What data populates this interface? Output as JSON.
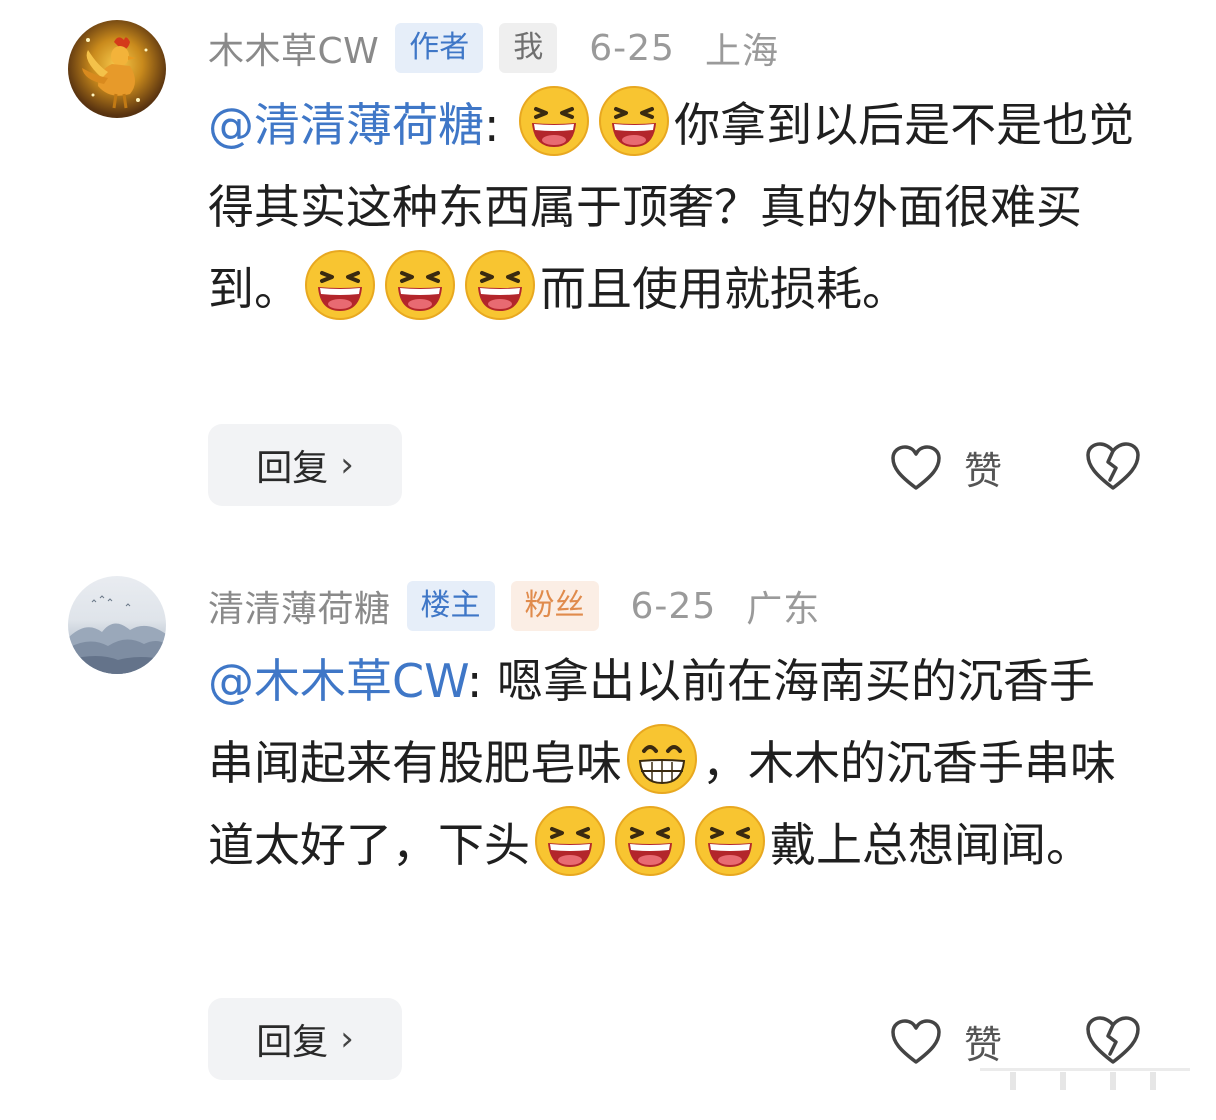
{
  "comments": [
    {
      "username": "木木草CW",
      "tags": [
        "作者",
        "我"
      ],
      "date": "6-25",
      "location": "上海",
      "mention": "@清清薄荷糖",
      "text_1": ": ",
      "text_2": "你拿到以后是不是也觉得其实这种东西属于顶奢？真的外面很难买到。",
      "text_3": "而且使用就损耗。",
      "reply_label": "回复",
      "like_label": "赞"
    },
    {
      "username": "清清薄荷糖",
      "tags": [
        "楼主",
        "粉丝"
      ],
      "date": "6-25",
      "location": "广东",
      "mention": "@木木草CW",
      "text_1": ": 嗯拿出以前在海南买的沉香手串闻起来有股肥皂味",
      "text_2": "，木木的沉香手串味道太好了，下头",
      "text_3": "戴上总想闻闻。",
      "reply_label": "回复",
      "like_label": "赞"
    }
  ],
  "icons": {
    "laugh_emoji": "laughing-face-icon",
    "grin_emoji": "grinning-face-icon",
    "like": "heart-outline-icon",
    "dislike": "broken-heart-icon",
    "chevron": "chevron-right-icon"
  },
  "colors": {
    "mention": "#3f77c7",
    "tag_blue": "#3f77c7",
    "tag_orange": "#e08b4c",
    "meta": "#9a9a9a"
  }
}
